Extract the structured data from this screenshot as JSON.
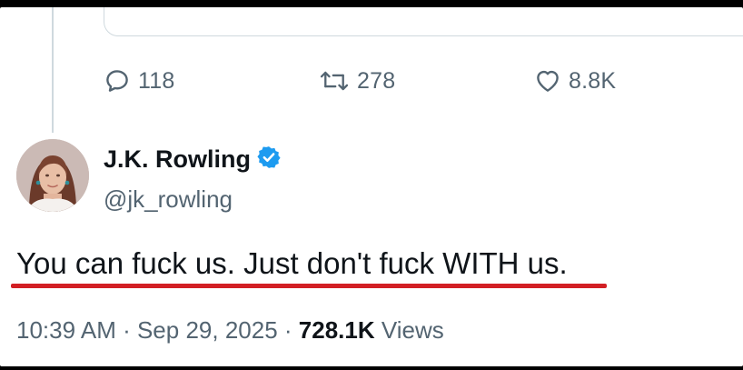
{
  "actions": {
    "replies": "118",
    "retweets": "278",
    "likes": "8.8K"
  },
  "author": {
    "display_name": "J.K. Rowling",
    "handle": "@jk_rowling",
    "verified_badge": "verified-badge-icon"
  },
  "tweet": {
    "text": "You can fuck us. Just don't fuck WITH us."
  },
  "meta": {
    "time": "10:39 AM",
    "separator": " · ",
    "date": "Sep 29, 2025",
    "views_count": "728.1K",
    "views_label": " Views"
  },
  "colors": {
    "verified_blue": "#1d9bf0",
    "secondary_text": "#536471",
    "primary_text": "#0f1419",
    "highlight_underline": "#d21f24"
  }
}
